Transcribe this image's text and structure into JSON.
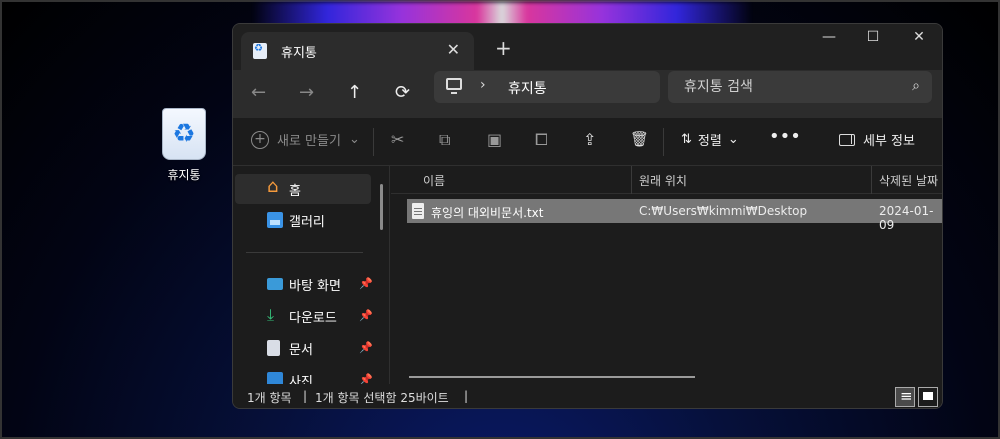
{
  "desktop": {
    "recycle_bin_label": "휴지통"
  },
  "window": {
    "tab_title": "휴지통",
    "tab_close": "✕",
    "new_tab": "+",
    "minimize": "—",
    "maximize": "☐",
    "close": "✕"
  },
  "nav": {
    "back": "←",
    "forward": "→",
    "up": "↑",
    "refresh": "⟳",
    "breadcrumb_sep": "›",
    "breadcrumb": "휴지통",
    "search_placeholder": "휴지통 검색",
    "search_icon": "⌕"
  },
  "toolbar": {
    "new_label": "새로 만들기",
    "new_caret": "⌄",
    "cut": "✂",
    "copy": "⧉",
    "paste": "▣",
    "rename": "⧠",
    "share": "⇪",
    "delete": "🗑",
    "sort_icon": "⇅",
    "sort_label": "정렬",
    "sort_caret": "⌄",
    "more": "•••",
    "details_label": "세부 정보"
  },
  "sidebar": {
    "items": [
      {
        "label": "홈",
        "icon": "home-icon"
      },
      {
        "label": "갤러리",
        "icon": "gallery-icon"
      },
      {
        "label": "바탕 화면",
        "icon": "desktop-folder-icon",
        "pin": "📌"
      },
      {
        "label": "다운로드",
        "icon": "download-icon",
        "pin": "📌"
      },
      {
        "label": "문서",
        "icon": "document-folder-icon",
        "pin": "📌"
      },
      {
        "label": "사진",
        "icon": "pictures-folder-icon",
        "pin": "📌"
      }
    ]
  },
  "columns": {
    "name": "이름",
    "original_location": "원래 위치",
    "date_deleted": "삭제된 날짜"
  },
  "files": [
    {
      "name": "휴잉의 대외비문서.txt",
      "original_location": "C:₩Users₩kimmi₩Desktop",
      "date_deleted": "2024-01-09"
    }
  ],
  "status": {
    "item_count": "1개 항목",
    "sep": "|",
    "selection": "1개 항목 선택함 25바이트",
    "sep2": "|"
  }
}
